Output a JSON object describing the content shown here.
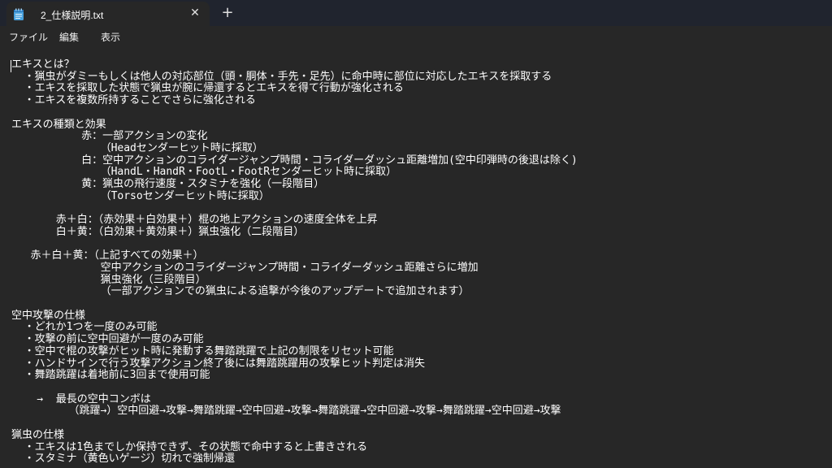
{
  "window": {
    "tab_title": "2_仕様説明.txt",
    "close_symbol": "✕",
    "new_tab_symbol": "+",
    "app_icon": "notepad-icon"
  },
  "menu": {
    "file": "ファイル",
    "edit": "編集",
    "view": "表示"
  },
  "document": {
    "lines": [
      "エキスとは？",
      "  ・猟虫がダミーもしくは他人の対応部位（頭・胴体・手先・足先）に命中時に部位に対応したエキスを採取する",
      "  ・エキスを採取した状態で猟虫が腕に帰還するとエキスを得て行動が強化される",
      "  ・エキスを複数所持することでさらに強化される",
      "",
      "エキスの種類と効果",
      "           赤：一部アクションの変化",
      "              （Headセンダーヒット時に採取）",
      "           白：空中アクションのコライダージャンプ時間・コライダーダッシュ距離増加(空中印弾時の後退は除く)",
      "              （HandL・HandR・FootL・FootRセンダーヒット時に採取）",
      "           黄：猟虫の飛行速度・スタミナを強化（一段階目）",
      "              （Torsoセンダーヒット時に採取）",
      "",
      "       赤＋白：（赤効果＋白効果＋）棍の地上アクションの速度全体を上昇",
      "       白＋黄：（白効果＋黄効果＋）猟虫強化（二段階目）",
      "",
      "   赤＋白＋黄：（上記すべての効果＋）",
      "              空中アクションのコライダージャンプ時間・コライダーダッシュ距離さらに増加",
      "              猟虫強化（三段階目）",
      "              （一部アクションでの猟虫による追撃が今後のアップデートで追加されます）",
      "",
      "空中攻撃の仕様",
      "  ・どれか1つを一度のみ可能",
      "  ・攻撃の前に空中回避が一度のみ可能",
      "  ・空中で棍の攻撃がヒット時に発動する舞踏跳躍で上記の制限をリセット可能",
      "  ・ハンドサインで行う攻撃アクション終了後には舞踏跳躍用の攻撃ヒット判定は消失",
      "  ・舞踏跳躍は着地前に3回まで使用可能",
      "",
      "    →  最長の空中コンボは",
      "         （跳躍→）空中回避→攻撃→舞踏跳躍→空中回避→攻撃→舞踏跳躍→空中回避→攻撃→舞踏跳躍→空中回避→攻撃",
      "",
      "猟虫の仕様",
      "  ・エキスは1色までしか保持できず、その状態で命中すると上書きされる",
      "  ・スタミナ（黄色いゲージ）切れで強制帰還"
    ]
  }
}
